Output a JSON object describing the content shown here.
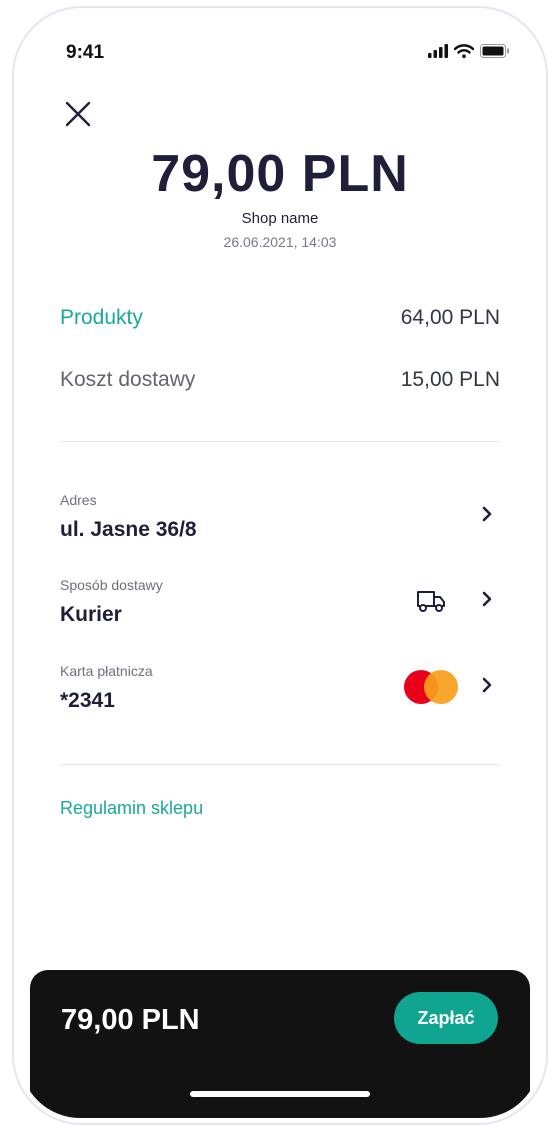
{
  "status_bar": {
    "time": "9:41"
  },
  "header": {
    "amount": "79,00 PLN",
    "shop_name": "Shop name",
    "date": "26.06.2021, 14:03"
  },
  "summary": {
    "products_label": "Produkty",
    "products_value": "64,00 PLN",
    "shipping_label": "Koszt dostawy",
    "shipping_value": "15,00 PLN"
  },
  "details": {
    "address_label": "Adres",
    "address_value": "ul. Jasne 36/8",
    "delivery_label": "Sposób dostawy",
    "delivery_value": "Kurier",
    "card_label": "Karta płatnicza",
    "card_value": "*2341"
  },
  "terms_link": "Regulamin sklepu",
  "footer": {
    "amount": "79,00 PLN",
    "pay_label": "Zapłać"
  },
  "colors": {
    "accent": "#19a99a",
    "pay_button": "#0fa590",
    "footer_bg": "#121212",
    "text_dark": "#1f1f3a"
  },
  "icons": [
    "close-icon",
    "chevron-right-icon",
    "truck-icon",
    "mastercard-icon",
    "signal-icon",
    "wifi-icon",
    "battery-icon"
  ]
}
